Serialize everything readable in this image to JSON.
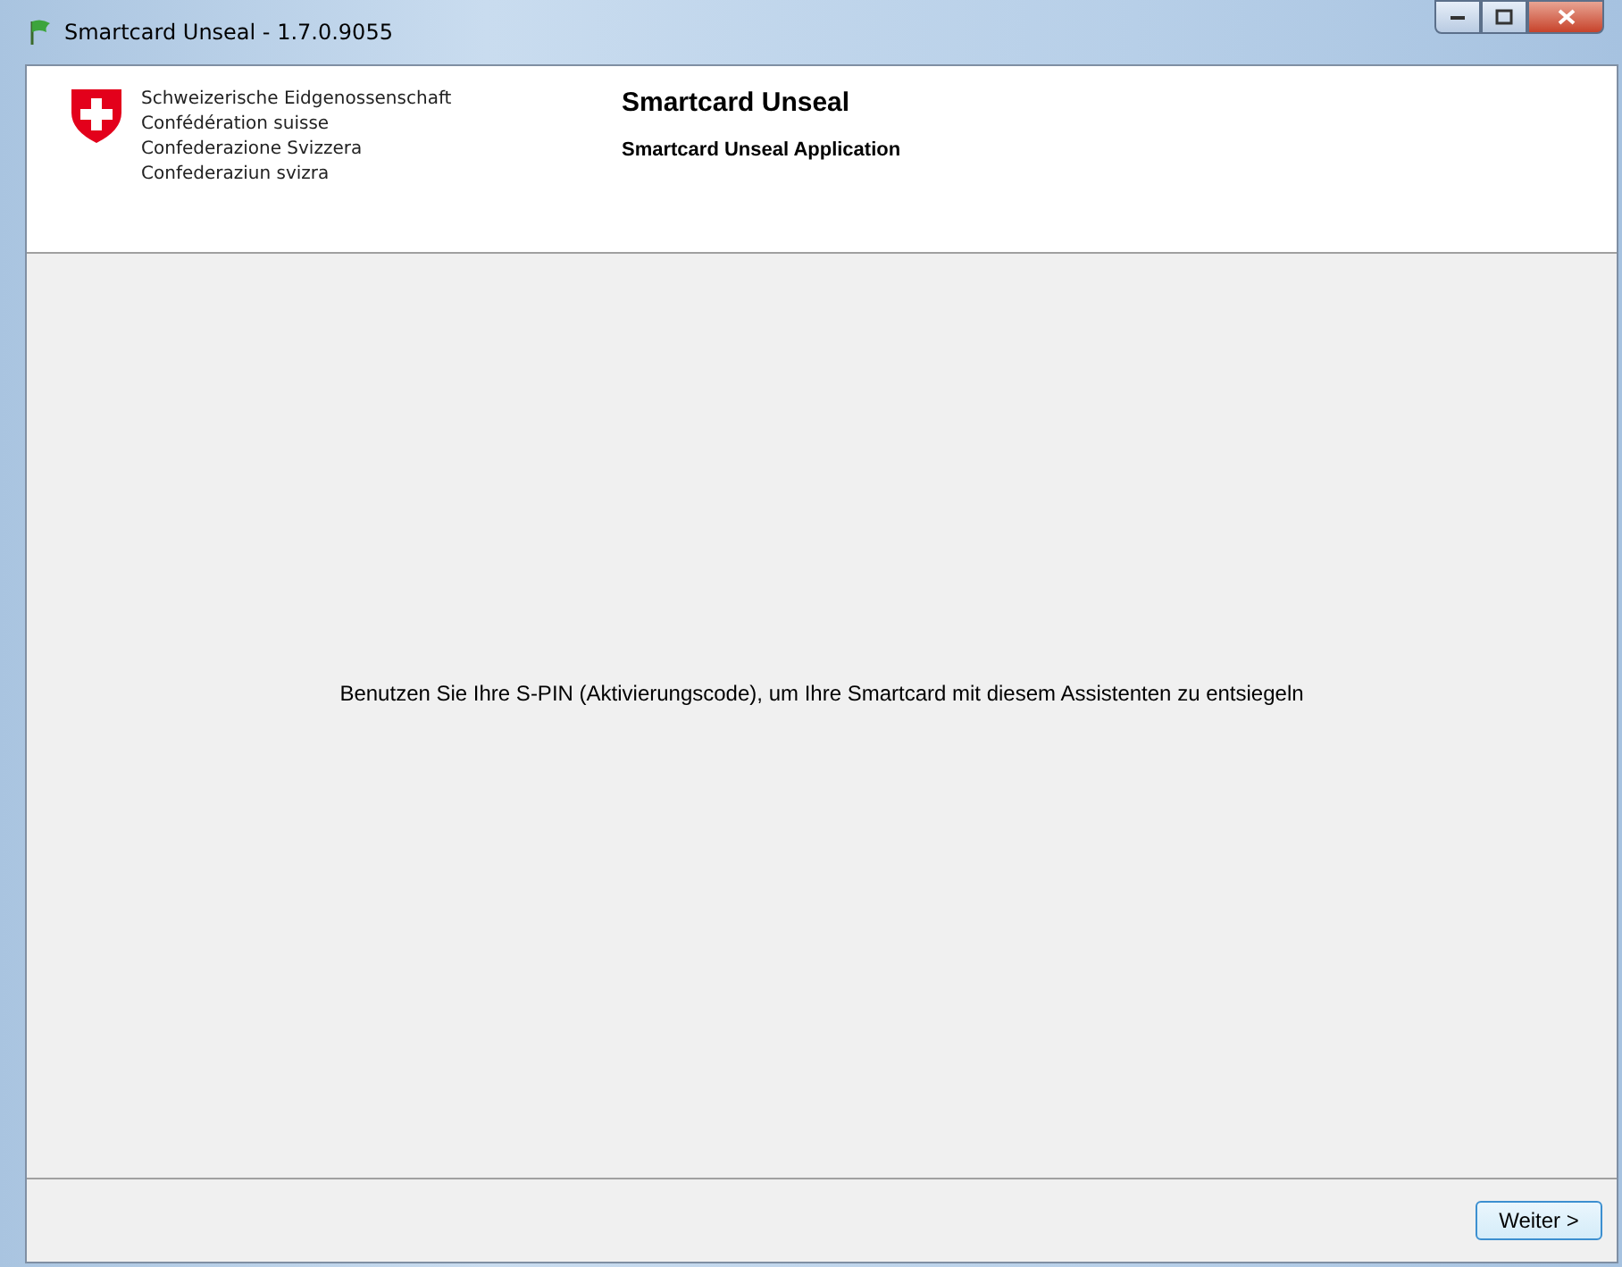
{
  "window": {
    "title": "Smartcard Unseal - 1.7.0.9055"
  },
  "header": {
    "org_names": [
      "Schweizerische Eidgenossenschaft",
      "Confédération suisse",
      "Confederazione Svizzera",
      "Confederaziun svizra"
    ],
    "title": "Smartcard Unseal",
    "subtitle": "Smartcard Unseal Application"
  },
  "body": {
    "message": "Benutzen Sie Ihre S-PIN (Aktivierungscode), um Ihre Smartcard mit diesem Assistenten zu entsiegeln"
  },
  "footer": {
    "buttons": [
      "Weiter >"
    ]
  }
}
